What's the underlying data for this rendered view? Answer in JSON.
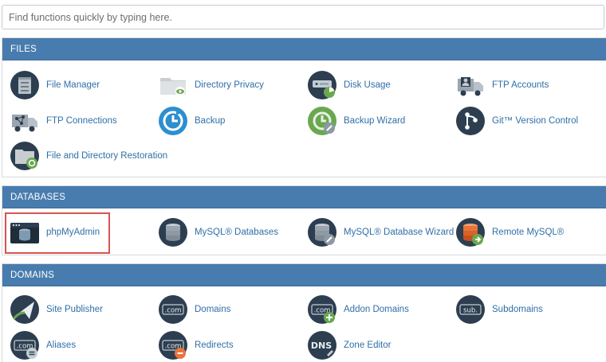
{
  "search": {
    "placeholder": "Find functions quickly by typing here."
  },
  "files": {
    "title": "FILES",
    "items": [
      {
        "label": "File Manager",
        "icon": "file-manager-icon"
      },
      {
        "label": "Directory Privacy",
        "icon": "directory-privacy-icon"
      },
      {
        "label": "Disk Usage",
        "icon": "disk-usage-icon"
      },
      {
        "label": "FTP Accounts",
        "icon": "ftp-accounts-icon"
      },
      {
        "label": "FTP Connections",
        "icon": "ftp-connections-icon"
      },
      {
        "label": "Backup",
        "icon": "backup-icon"
      },
      {
        "label": "Backup Wizard",
        "icon": "backup-wizard-icon"
      },
      {
        "label": "Git™ Version Control",
        "icon": "git-icon"
      },
      {
        "label": "File and Directory Restoration",
        "icon": "file-restoration-icon"
      }
    ]
  },
  "databases": {
    "title": "DATABASES",
    "items": [
      {
        "label": "phpMyAdmin",
        "icon": "phpmyadmin-icon"
      },
      {
        "label": "MySQL® Databases",
        "icon": "mysql-databases-icon"
      },
      {
        "label": "MySQL® Database Wizard",
        "icon": "mysql-wizard-icon"
      },
      {
        "label": "Remote MySQL®",
        "icon": "remote-mysql-icon"
      }
    ]
  },
  "domains": {
    "title": "DOMAINS",
    "items": [
      {
        "label": "Site Publisher",
        "icon": "site-publisher-icon"
      },
      {
        "label": "Domains",
        "icon": "domains-icon",
        "badge": ".com"
      },
      {
        "label": "Addon Domains",
        "icon": "addon-domains-icon",
        "badge": ".com"
      },
      {
        "label": "Subdomains",
        "icon": "subdomains-icon",
        "badge": "sub."
      },
      {
        "label": "Aliases",
        "icon": "aliases-icon",
        "badge": ".com"
      },
      {
        "label": "Redirects",
        "icon": "redirects-icon",
        "badge": ".com"
      },
      {
        "label": "Zone Editor",
        "icon": "zone-editor-icon",
        "badge": "DNS"
      }
    ]
  },
  "colors": {
    "header_bg": "#487cae",
    "link": "#2f6fa8",
    "icon_dark": "#2c3e50",
    "icon_green": "#6aa84f",
    "highlight": "#d9534f"
  }
}
